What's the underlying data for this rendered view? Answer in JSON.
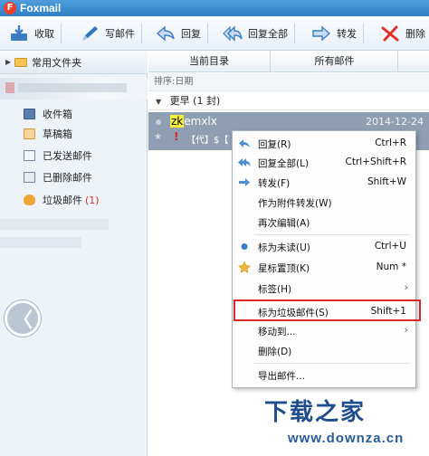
{
  "app": {
    "title": "Foxmail",
    "logo": "foxmail-logo"
  },
  "toolbar": {
    "buttons": [
      {
        "label": "收取",
        "icon": "inbox-download-icon"
      },
      {
        "label": "写邮件",
        "icon": "compose-pen-icon"
      },
      {
        "label": "回复",
        "icon": "reply-arrow-icon"
      },
      {
        "label": "回复全部",
        "icon": "reply-all-arrow-icon"
      },
      {
        "label": "转发",
        "icon": "forward-arrow-icon"
      },
      {
        "label": "删除",
        "icon": "delete-x-icon"
      }
    ]
  },
  "sidebar": {
    "header": "常用文件夹",
    "folders": [
      {
        "label": "收件箱",
        "count": "",
        "icon": "inbox-icon"
      },
      {
        "label": "草稿箱",
        "count": "",
        "icon": "drafts-icon"
      },
      {
        "label": "已发送邮件",
        "count": "",
        "icon": "sent-icon"
      },
      {
        "label": "已删除邮件",
        "count": "",
        "icon": "trash-icon"
      },
      {
        "label": "垃圾邮件",
        "count": "(1)",
        "icon": "junk-icon"
      }
    ],
    "back_glyph": "〈"
  },
  "list": {
    "tabs": [
      "当前目录",
      "所有邮件"
    ],
    "sort_label": "排序:日期",
    "group_label": "更早 (1 封)",
    "message": {
      "sender_highlight": "zk",
      "sender_rest": "emxlx",
      "date": "2014-12-24",
      "flag": "!",
      "subject": "【代】$【"
    }
  },
  "context_menu": {
    "items": [
      {
        "label": "回复(R)",
        "shortcut": "Ctrl+R",
        "icon": "reply-arrow-icon",
        "submenu": false
      },
      {
        "label": "回复全部(L)",
        "shortcut": "Ctrl+Shift+R",
        "icon": "reply-all-arrow-icon",
        "submenu": false
      },
      {
        "label": "转发(F)",
        "shortcut": "Shift+W",
        "icon": "forward-arrow-icon",
        "submenu": false
      },
      {
        "label": "作为附件转发(W)",
        "shortcut": "",
        "icon": "",
        "submenu": false
      },
      {
        "label": "再次编辑(A)",
        "shortcut": "",
        "icon": "",
        "submenu": false
      },
      {
        "label": "标为未读(U)",
        "shortcut": "Ctrl+U",
        "icon": "unread-dot-icon",
        "submenu": false
      },
      {
        "label": "星标置顶(K)",
        "shortcut": "Num *",
        "icon": "star-icon",
        "submenu": false
      },
      {
        "label": "标签(H)",
        "shortcut": "",
        "icon": "",
        "submenu": true
      },
      {
        "label": "标为垃圾邮件(S)",
        "shortcut": "Shift+1",
        "icon": "",
        "submenu": false
      },
      {
        "label": "移动到...",
        "shortcut": "",
        "icon": "",
        "submenu": true
      },
      {
        "label": "删除(D)",
        "shortcut": "",
        "icon": "",
        "submenu": false
      },
      {
        "label": "导出邮件...",
        "shortcut": "",
        "icon": "",
        "submenu": false
      }
    ],
    "submenu_glyph": "›"
  },
  "watermark": {
    "main": "下载之家",
    "url": "www.downza.cn"
  },
  "colors": {
    "titlebar": "#2f7fc4",
    "selected_row": "#8e9fb3",
    "highlight_border": "#e02727",
    "sender_highlight": "#f7ef35",
    "junk_count": "#d03030",
    "watermark": "#1e4e8c"
  }
}
